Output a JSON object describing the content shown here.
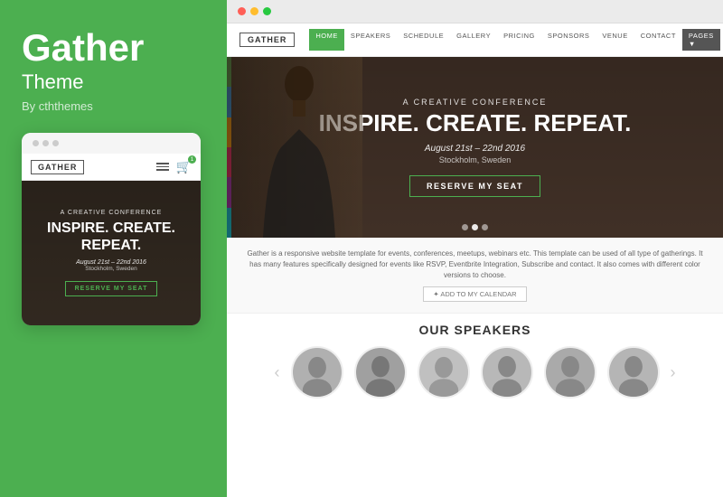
{
  "left": {
    "title": "Gather",
    "subtitle": "Theme",
    "author": "By cththemes"
  },
  "mobile": {
    "logo": "GATHER",
    "hero_sub": "A CREATIVE CONFERENCE",
    "hero_title": "INSPIRE. CREATE. REPEAT.",
    "hero_date": "August 21st – 22nd 2016",
    "hero_city": "Stockholm, Sweden",
    "cta": "RESERVE MY SEAT",
    "cart_count": "1"
  },
  "desktop": {
    "logo": "GATHER",
    "nav": {
      "home": "HOME",
      "speakers": "SPEAKERS",
      "schedule": "SCHEDULE",
      "gallery": "GALLERY",
      "pricing": "PRICING",
      "sponsors": "SPONSORS",
      "venue": "VENUE",
      "contact": "CONTACT",
      "pages": "PAGES ▼"
    },
    "hero": {
      "sub": "A CREATIVE CONFERENCE",
      "title": "INSPIRE. CREATE. REPEAT.",
      "date": "August 21st – 22nd 2016",
      "city": "Stockholm, Sweden",
      "cta": "RESERVE MY SEAT"
    },
    "description": "Gather is a responsive website template for events, conferences, meetups, webinars etc. This template can be used of all type of gatherings. It has many features specifically designed for events like RSVP, Eventbrite Integration, Subscribe and contact. It also comes with different color versions to choose.",
    "add_calendar": "✦ ADD TO MY CALENDAR",
    "speakers_title": "OUR SPEAKERS",
    "carousel_prev": "‹",
    "carousel_next": "›"
  },
  "colors": {
    "accent": "#4caf50",
    "bar1": "#4caf50",
    "bar2": "#2196f3",
    "bar3": "#ff9800",
    "bar4": "#e91e63",
    "bar5": "#9c27b0",
    "bar6": "#00bcd4"
  }
}
